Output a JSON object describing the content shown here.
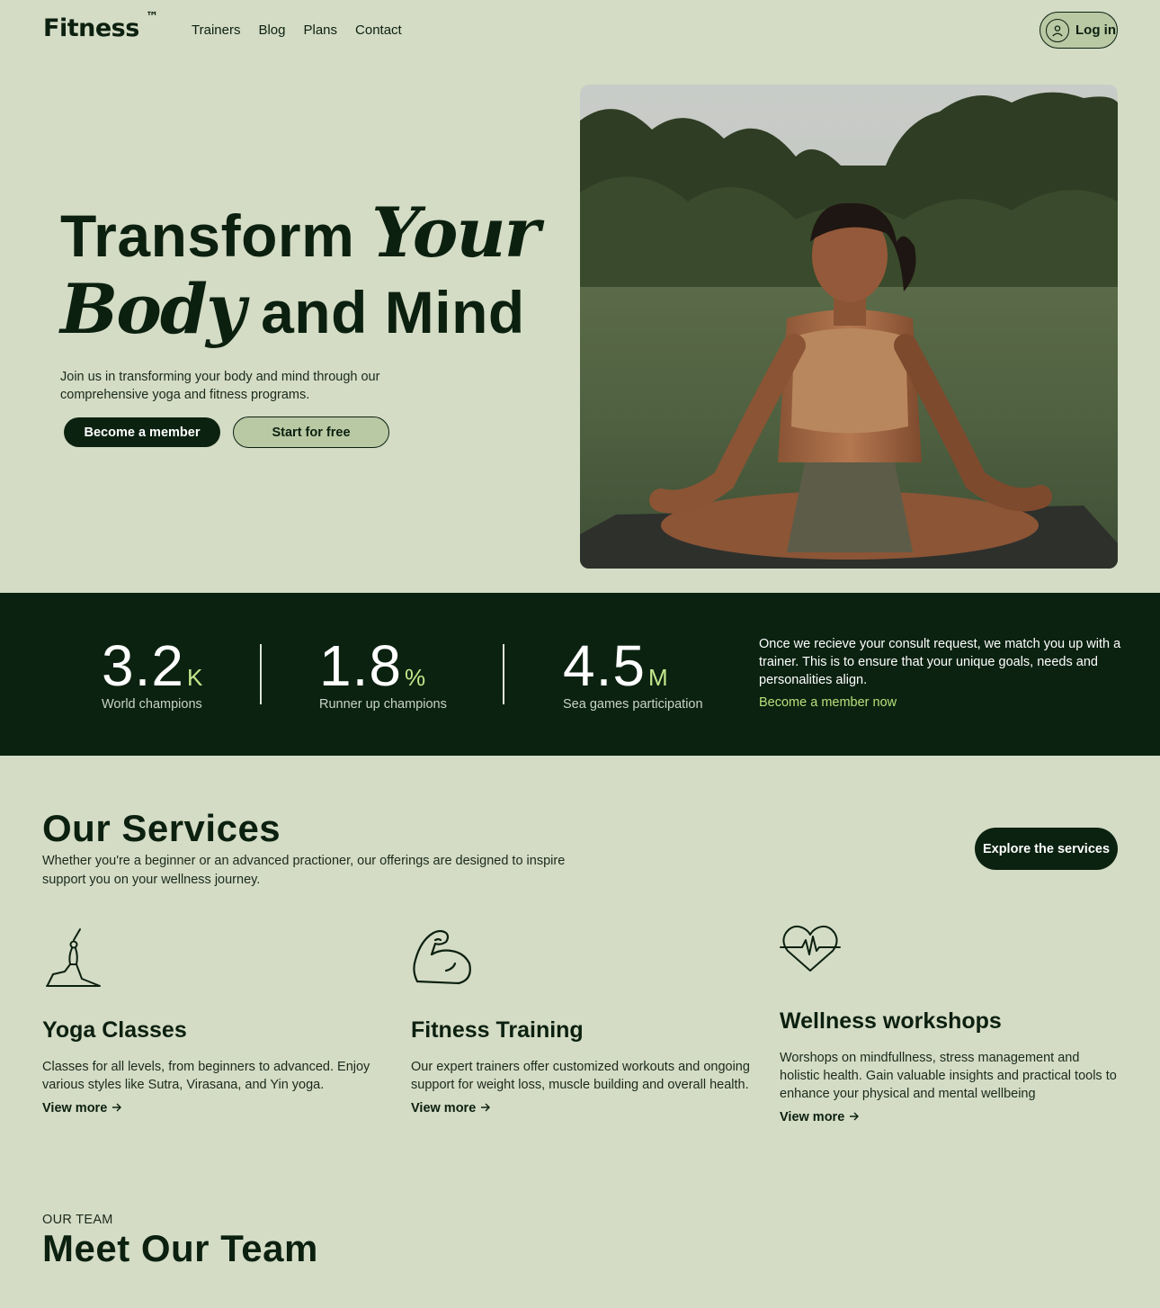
{
  "nav": {
    "logo": "Fitness",
    "logo_mark": "™",
    "links": [
      "Trainers",
      "Blog",
      "Plans",
      "Contact"
    ],
    "login_label": "Log in",
    "login_icon": "user-circle-icon"
  },
  "hero": {
    "title_part1": "Transform",
    "title_script1": "Your",
    "title_script2": "Body",
    "title_part2": "and Mind",
    "subtitle": "Join us in transforming your body and mind through our comprehensive yoga and fitness programs.",
    "primary_button": "Become a member",
    "secondary_button": "Start for free"
  },
  "stats": {
    "items": [
      {
        "number": "3.2",
        "unit": "K",
        "label": "World champions"
      },
      {
        "number": "1.8",
        "unit": "%",
        "label": "Runner up champions"
      },
      {
        "number": "4.5",
        "unit": "M",
        "label": "Sea games participation"
      }
    ],
    "description": "Once we recieve your consult request, we match you up with a trainer. This is to ensure that your unique goals, needs and personalities align.",
    "link": "Become a member now"
  },
  "services": {
    "title": "Our Services",
    "subtitle": "Whether you're a beginner or an advanced practioner, our offerings are designed to inspire support you on your wellness journey.",
    "button": "Explore the services",
    "items": [
      {
        "icon": "yoga-pose-icon",
        "title": "Yoga Classes",
        "description": "Classes for all levels, from beginners to advanced. Enjoy various styles like Sutra, Virasana, and Yin yoga.",
        "link": "View more"
      },
      {
        "icon": "flexed-arm-icon",
        "title": "Fitness Training",
        "description": "Our expert trainers offer customized workouts and ongoing support for weight loss, muscle building and overall health.",
        "link": "View more"
      },
      {
        "icon": "heartbeat-icon",
        "title": "Wellness workshops",
        "description": "Worshops on mindfullness, stress management and holistic health. Gain valuable insights and practical tools to enhance your physical and mental wellbeing",
        "link": "View more"
      }
    ]
  },
  "team": {
    "eyebrow": "OUR TEAM",
    "title": "Meet Our Team"
  }
}
